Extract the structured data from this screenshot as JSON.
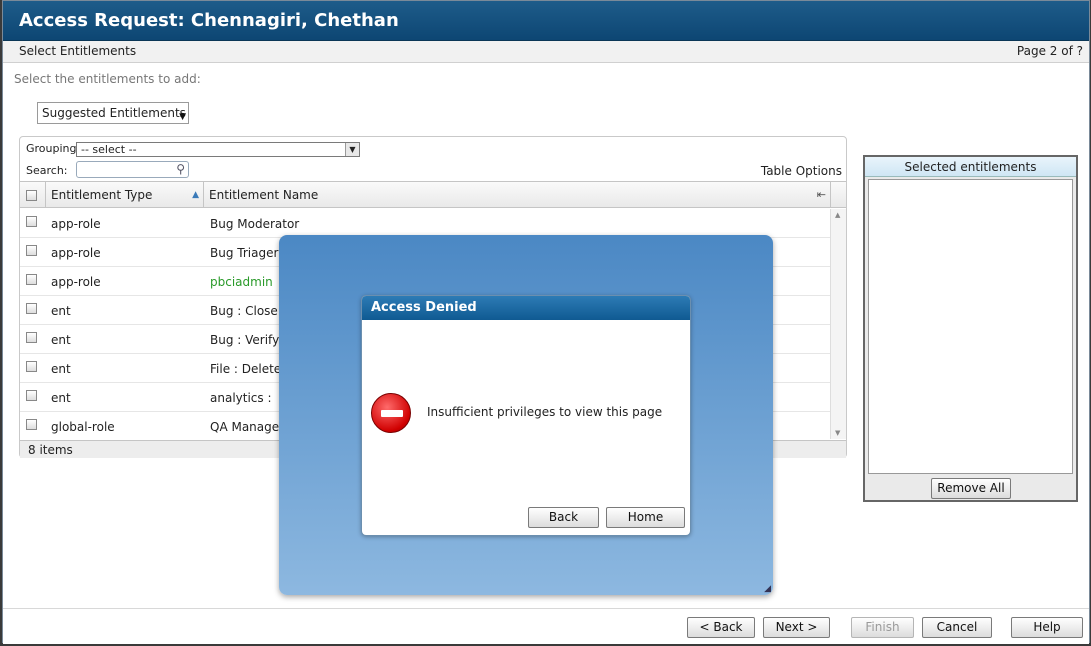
{
  "header": {
    "title": "Access Request: Chennagiri, Chethan"
  },
  "subheader": {
    "step": "Select Entitlements",
    "page": "Page 2 of ?"
  },
  "instruction": "Select the entitlements to add:",
  "source_select": {
    "value": "Suggested Entitlements"
  },
  "table": {
    "grouping_label": "Grouping:",
    "grouping_value": "-- select --",
    "search_label": "Search:",
    "table_options": "Table Options",
    "columns": [
      "Entitlement Type",
      "Entitlement Name"
    ],
    "rows": [
      {
        "type": "app-role",
        "name": "Bug Moderator"
      },
      {
        "type": "app-role",
        "name": "Bug Triager"
      },
      {
        "type": "app-role",
        "name": "pbciadmin"
      },
      {
        "type": "ent",
        "name": "Bug : Close"
      },
      {
        "type": "ent",
        "name": "Bug : Verify"
      },
      {
        "type": "ent",
        "name": "File : Delete"
      },
      {
        "type": "ent",
        "name": "analytics :"
      },
      {
        "type": "global-role",
        "name": "QA Manager"
      }
    ],
    "footer": "8 items"
  },
  "selected_panel": {
    "title": "Selected entitlements",
    "remove_all": "Remove All"
  },
  "dialog": {
    "title": "Access Denied",
    "message": "Insufficient privileges to view this page",
    "back": "Back",
    "home": "Home",
    "icon": "stop-icon"
  },
  "footer_buttons": {
    "back": "< Back",
    "next": "Next >",
    "finish": "Finish",
    "cancel": "Cancel",
    "help": "Help"
  },
  "colors": {
    "title_bar": "#0d4673",
    "highlight_name": "#2a9a2a",
    "overlay": "#4b88c4"
  }
}
